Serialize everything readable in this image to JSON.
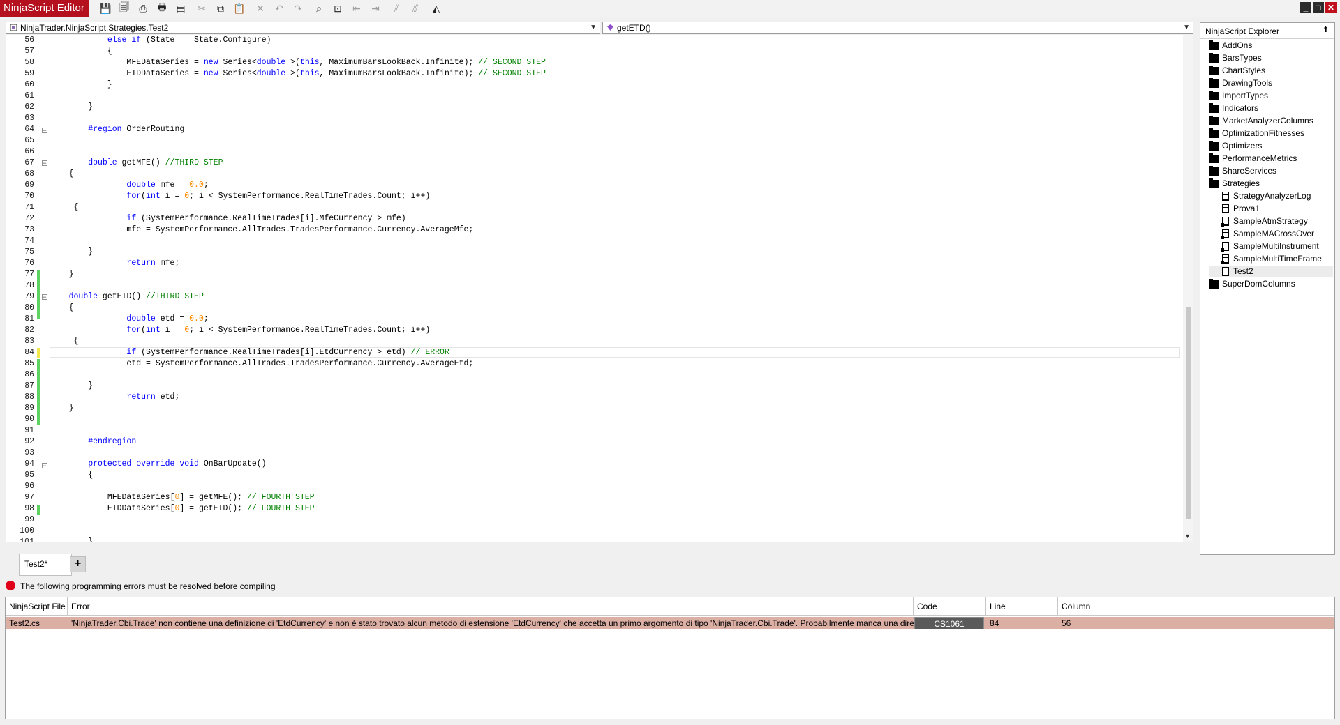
{
  "app": {
    "title": "NinjaScript Editor"
  },
  "editor": {
    "class_combo": "NinjaTrader.NinjaScript.Strategies.Test2",
    "member_combo": "getETD()",
    "lines": [
      {
        "n": "56",
        "parts": [
          [
            "",
            "            "
          ],
          [
            "k",
            "else if"
          ],
          [
            "",
            " (State == State.Configure)"
          ]
        ]
      },
      {
        "n": "57",
        "parts": [
          [
            "",
            "            {"
          ]
        ]
      },
      {
        "n": "58",
        "parts": [
          [
            "",
            "                MFEDataSeries = "
          ],
          [
            "k",
            "new"
          ],
          [
            "",
            " Series<"
          ],
          [
            "k",
            "double"
          ],
          [
            "",
            " >("
          ],
          [
            "k",
            "this"
          ],
          [
            "",
            ", MaximumBarsLookBack.Infinite); "
          ],
          [
            "c",
            "// SECOND STEP"
          ]
        ]
      },
      {
        "n": "59",
        "parts": [
          [
            "",
            "                ETDDataSeries = "
          ],
          [
            "k",
            "new"
          ],
          [
            "",
            " Series<"
          ],
          [
            "k",
            "double"
          ],
          [
            "",
            " >("
          ],
          [
            "k",
            "this"
          ],
          [
            "",
            ", MaximumBarsLookBack.Infinite); "
          ],
          [
            "c",
            "// SECOND STEP"
          ]
        ]
      },
      {
        "n": "60",
        "parts": [
          [
            "",
            "            }"
          ]
        ]
      },
      {
        "n": "61",
        "parts": []
      },
      {
        "n": "62",
        "parts": [
          [
            "",
            "        }"
          ]
        ]
      },
      {
        "n": "63",
        "parts": []
      },
      {
        "n": "64",
        "parts": [
          [
            "",
            "        "
          ],
          [
            "k",
            "#region"
          ],
          [
            "",
            " OrderRouting"
          ]
        ]
      },
      {
        "n": "65",
        "parts": []
      },
      {
        "n": "66",
        "parts": []
      },
      {
        "n": "67",
        "parts": [
          [
            "",
            "        "
          ],
          [
            "k",
            "double"
          ],
          [
            "",
            " getMFE() "
          ],
          [
            "c",
            "//THIRD STEP"
          ]
        ]
      },
      {
        "n": "68",
        "parts": [
          [
            "",
            "    {"
          ]
        ]
      },
      {
        "n": "69",
        "parts": [
          [
            "",
            "                "
          ],
          [
            "k",
            "double"
          ],
          [
            "",
            " mfe = "
          ],
          [
            "n",
            "0.0"
          ],
          [
            "",
            ";"
          ]
        ]
      },
      {
        "n": "70",
        "parts": [
          [
            "",
            "                "
          ],
          [
            "k",
            "for"
          ],
          [
            "",
            "("
          ],
          [
            "k",
            "int"
          ],
          [
            "",
            " i = "
          ],
          [
            "n",
            "0"
          ],
          [
            "",
            "; i < SystemPerformance.RealTimeTrades.Count; i++)"
          ]
        ]
      },
      {
        "n": "71",
        "parts": [
          [
            "",
            "     {"
          ]
        ]
      },
      {
        "n": "72",
        "parts": [
          [
            "",
            "                "
          ],
          [
            "k",
            "if"
          ],
          [
            "",
            " (SystemPerformance.RealTimeTrades[i].MfeCurrency > mfe)"
          ]
        ]
      },
      {
        "n": "73",
        "parts": [
          [
            "",
            "                mfe = SystemPerformance.AllTrades.TradesPerformance.Currency.AverageMfe;"
          ]
        ]
      },
      {
        "n": "74",
        "parts": []
      },
      {
        "n": "75",
        "parts": [
          [
            "",
            "        }"
          ]
        ]
      },
      {
        "n": "76",
        "parts": [
          [
            "",
            "                "
          ],
          [
            "k",
            "return"
          ],
          [
            "",
            " mfe;"
          ]
        ]
      },
      {
        "n": "77",
        "parts": [
          [
            "",
            "    }"
          ]
        ]
      },
      {
        "n": "78",
        "parts": []
      },
      {
        "n": "79",
        "parts": [
          [
            "",
            "    "
          ],
          [
            "k",
            "double"
          ],
          [
            "",
            " getETD() "
          ],
          [
            "c",
            "//THIRD STEP"
          ]
        ]
      },
      {
        "n": "80",
        "parts": [
          [
            "",
            "    {"
          ]
        ]
      },
      {
        "n": "81",
        "parts": [
          [
            "",
            "                "
          ],
          [
            "k",
            "double"
          ],
          [
            "",
            " etd = "
          ],
          [
            "n",
            "0.0"
          ],
          [
            "",
            ";"
          ]
        ]
      },
      {
        "n": "82",
        "parts": [
          [
            "",
            "                "
          ],
          [
            "k",
            "for"
          ],
          [
            "",
            "("
          ],
          [
            "k",
            "int"
          ],
          [
            "",
            " i = "
          ],
          [
            "n",
            "0"
          ],
          [
            "",
            "; i < SystemPerformance.RealTimeTrades.Count; i++)"
          ]
        ]
      },
      {
        "n": "83",
        "parts": [
          [
            "",
            "     {"
          ]
        ]
      },
      {
        "n": "84",
        "parts": [
          [
            "",
            "                "
          ],
          [
            "k",
            "if"
          ],
          [
            "",
            " (SystemPerformance.RealTimeTrades[i].EtdCurrency > etd) "
          ],
          [
            "c",
            "// ERROR"
          ]
        ]
      },
      {
        "n": "85",
        "parts": [
          [
            "",
            "                etd = SystemPerformance.AllTrades.TradesPerformance.Currency.AverageEtd;"
          ]
        ]
      },
      {
        "n": "86",
        "parts": []
      },
      {
        "n": "87",
        "parts": [
          [
            "",
            "        }"
          ]
        ]
      },
      {
        "n": "88",
        "parts": [
          [
            "",
            "                "
          ],
          [
            "k",
            "return"
          ],
          [
            "",
            " etd;"
          ]
        ]
      },
      {
        "n": "89",
        "parts": [
          [
            "",
            "    }"
          ]
        ]
      },
      {
        "n": "90",
        "parts": []
      },
      {
        "n": "91",
        "parts": []
      },
      {
        "n": "92",
        "parts": [
          [
            "",
            "        "
          ],
          [
            "k",
            "#endregion"
          ]
        ]
      },
      {
        "n": "93",
        "parts": []
      },
      {
        "n": "94",
        "parts": [
          [
            "",
            "        "
          ],
          [
            "k",
            "protected override void"
          ],
          [
            "",
            " OnBarUpdate()"
          ]
        ]
      },
      {
        "n": "95",
        "parts": [
          [
            "",
            "        {"
          ]
        ]
      },
      {
        "n": "96",
        "parts": []
      },
      {
        "n": "97",
        "parts": [
          [
            "",
            "            MFEDataSeries["
          ],
          [
            "n",
            "0"
          ],
          [
            "",
            "] = getMFE(); "
          ],
          [
            "c",
            "// FOURTH STEP"
          ]
        ]
      },
      {
        "n": "98",
        "parts": [
          [
            "",
            "            ETDDataSeries["
          ],
          [
            "n",
            "0"
          ],
          [
            "",
            "] = getETD(); "
          ],
          [
            "c",
            "// FOURTH STEP"
          ]
        ]
      },
      {
        "n": "99",
        "parts": []
      },
      {
        "n": "100",
        "parts": []
      },
      {
        "n": "101",
        "parts": [
          [
            "",
            "        }"
          ]
        ]
      }
    ]
  },
  "explorer": {
    "title": "NinjaScript Explorer",
    "pin": "⬆",
    "folders": [
      "AddOns",
      "BarsTypes",
      "ChartStyles",
      "DrawingTools",
      "ImportTypes",
      "Indicators",
      "MarketAnalyzerColumns",
      "OptimizationFitnesses",
      "Optimizers",
      "PerformanceMetrics",
      "ShareServices",
      "Strategies"
    ],
    "strategies": [
      "StrategyAnalyzerLog",
      "Prova1",
      "SampleAtmStrategy",
      "SampleMACrossOver",
      "SampleMultiInstrument",
      "SampleMultiTimeFrame",
      "Test2"
    ],
    "last_folder": "SuperDomColumns"
  },
  "tabs": {
    "active": "Test2*",
    "add": "+"
  },
  "errors": {
    "message": "The following programming errors must be resolved before compiling",
    "columns": [
      "NinjaScript File",
      "Error",
      "Code",
      "Line",
      "Column"
    ],
    "row": {
      "file": "Test2.cs",
      "error": "'NinjaTrader.Cbi.Trade' non contiene una definizione di 'EtdCurrency' e non è stato trovato alcun metodo di estensione 'EtdCurrency' che accetta un primo argomento di tipo 'NinjaTrader.Cbi.Trade'. Probabilmente manca una direttiva using o un riferimento a un assembly.",
      "code": "CS1061",
      "line": "84",
      "column": "56"
    }
  },
  "colors": {
    "title_bg": "#b4101e",
    "change_marker": "#5fd35f",
    "error_row": "#dcafa5",
    "keyword": "#0000ff",
    "comment": "#008000",
    "number": "#ff8c00"
  }
}
